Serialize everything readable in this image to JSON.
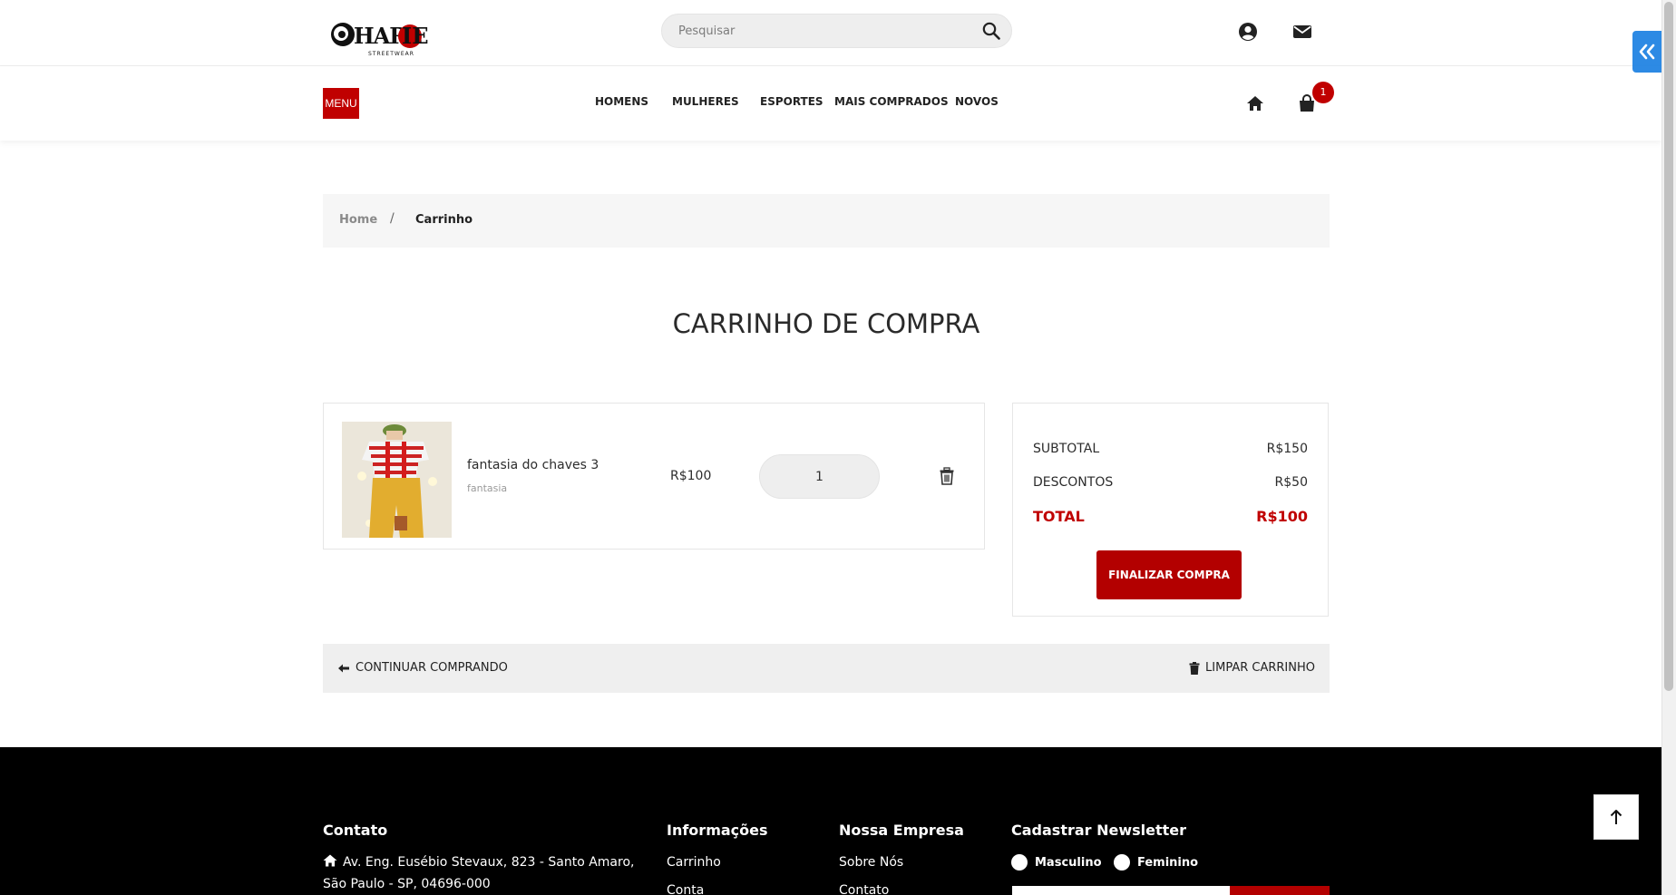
{
  "header": {
    "logo_alt": "Charlie Streetwear",
    "search_placeholder": "Pesquisar",
    "icons": [
      "search-icon",
      "user-circle-icon",
      "envelope-icon",
      "double-chevron-left-icon"
    ]
  },
  "nav": {
    "menu_label": "MENU",
    "items": [
      "HOMENS",
      "MULHERES",
      "ESPORTES",
      "MAIS COMPRADOS",
      "NOVOS"
    ],
    "cart_count": "1"
  },
  "breadcrumb": {
    "home": "Home",
    "separator": "/",
    "current": "Carrinho"
  },
  "page_title": "CARRINHO DE COMPRA",
  "cart": {
    "items": [
      {
        "name": "fantasia do chaves 3",
        "category": "fantasia",
        "price": "R$100",
        "quantity": "1"
      }
    ]
  },
  "totals": {
    "subtotal_label": "SUBTOTAL",
    "subtotal_value": "R$150",
    "discount_label": "DESCONTOS",
    "discount_value": "R$50",
    "total_label": "TOTAL",
    "total_value": "R$100",
    "checkout_label": "FINALIZAR COMPRA"
  },
  "actions": {
    "continue_label": "CONTINUAR COMPRANDO",
    "clear_label": "LIMPAR CARRINHO"
  },
  "footer": {
    "contact_heading": "Contato",
    "address": "Av. Eng. Eusébio Stevaux, 823 - Santo Amaro, São Paulo - SP, 04696-000",
    "info_heading": "Informações",
    "info_links": [
      "Carrinho",
      "Conta"
    ],
    "company_heading": "Nossa Empresa",
    "company_links": [
      "Sobre Nós",
      "Contato"
    ],
    "newsletter_heading": "Cadastrar Newsletter",
    "gender_options": [
      "Masculino",
      "Feminino"
    ]
  },
  "colors": {
    "brand": "#c00000",
    "button": "#b30000",
    "side_toggle": "#2d8ae4"
  }
}
